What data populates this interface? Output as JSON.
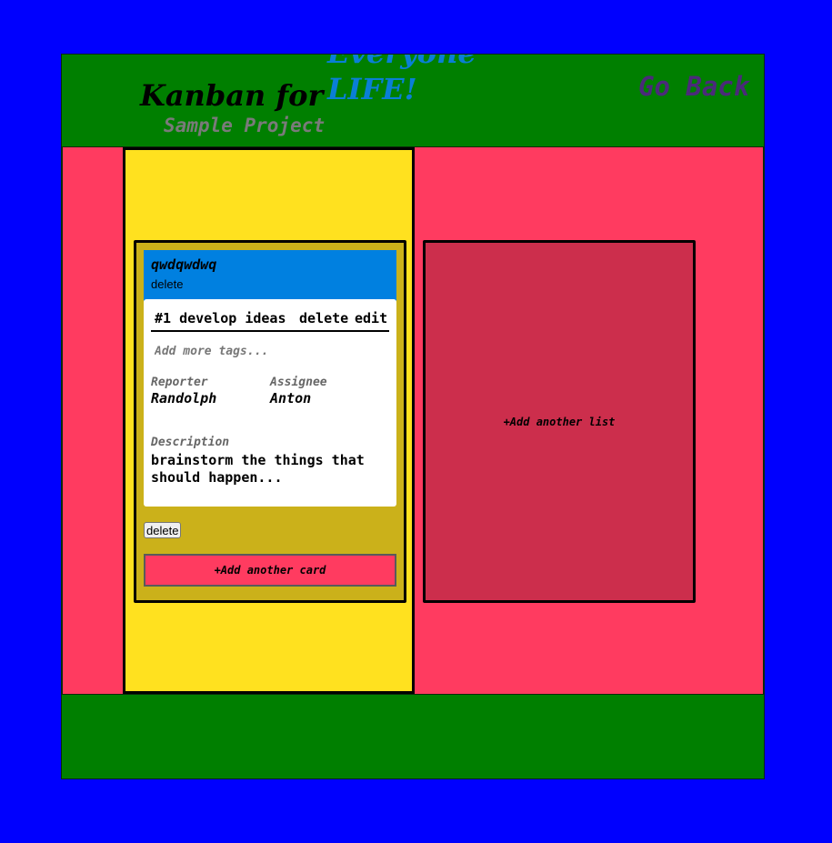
{
  "header": {
    "title": "Kanban for",
    "tagline_line1": "Everyone",
    "tagline_line2": "LIFE!",
    "project_name": "Sample Project",
    "go_back": "Go Back"
  },
  "lists": [
    {
      "name": "qwdqwdwq",
      "delete_label": "delete",
      "cards": [
        {
          "title": "#1 develop ideas",
          "delete_label": "delete",
          "edit_label": "edit",
          "tags_placeholder": "Add more tags...",
          "reporter_label": "Reporter",
          "reporter": "Randolph",
          "assignee_label": "Assignee",
          "assignee": "Anton",
          "description_label": "Description",
          "description": "brainstorm the things that should happen..."
        }
      ],
      "delete_button": "delete",
      "add_card": "+Add another card"
    }
  ],
  "add_list": "+Add another list",
  "colors": {
    "page_bg": "#0000fe",
    "header_bg": "#007f00",
    "board_bg": "#ff3b60",
    "list_column_bg": "#ffe11f",
    "list_bg": "#cbb11a",
    "list_header_bg": "#0080e0",
    "add_list_bg": "#cc2e4c",
    "go_back": "#4b2a7a",
    "tagline": "#0a7fd6"
  }
}
